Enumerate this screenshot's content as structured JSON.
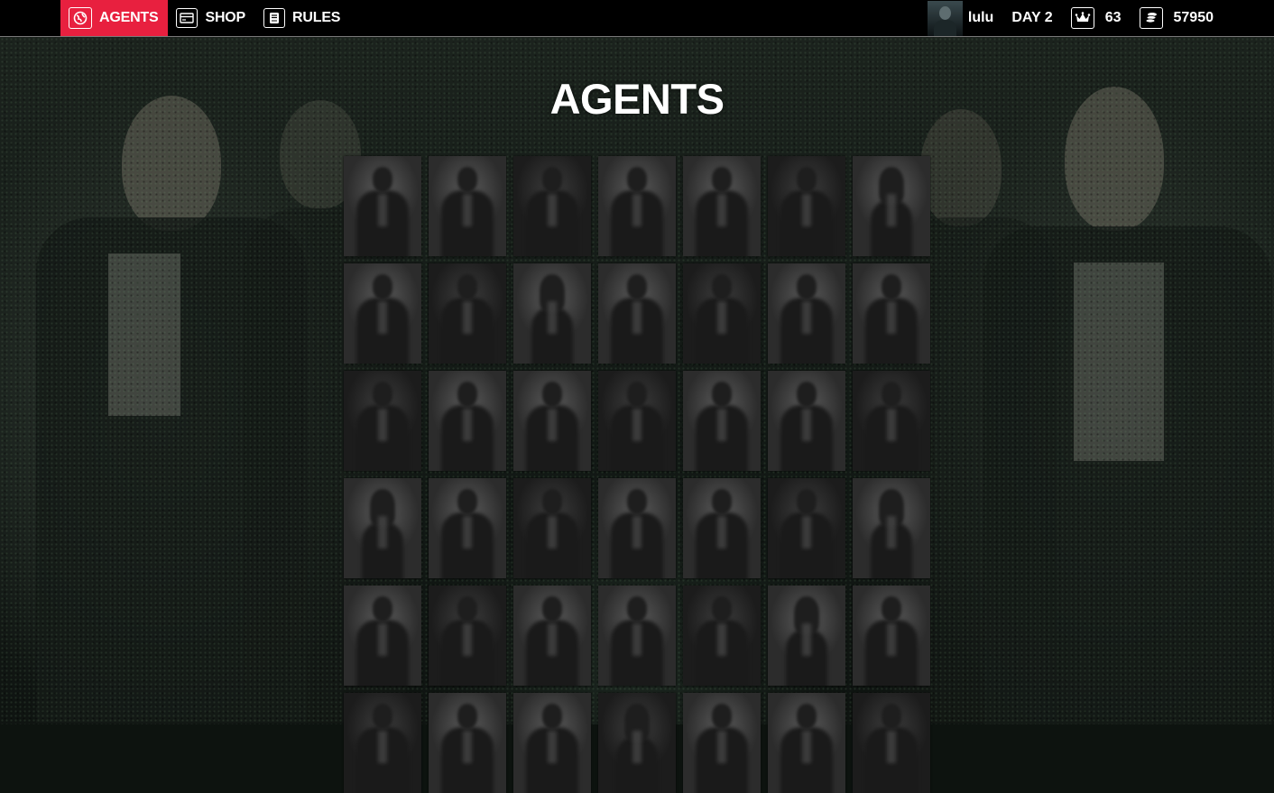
{
  "nav": {
    "items": [
      {
        "label": "AGENTS",
        "icon": "globe-icon",
        "active": true
      },
      {
        "label": "SHOP",
        "icon": "card-icon",
        "active": false
      },
      {
        "label": "RULES",
        "icon": "book-icon",
        "active": false
      }
    ]
  },
  "status": {
    "username": "lulu",
    "day": "DAY 2",
    "crown_value": "63",
    "coins_value": "57950"
  },
  "page": {
    "title": "AGENTS"
  },
  "agents": {
    "rows": [
      [
        "male",
        "male",
        "male",
        "male",
        "male",
        "male",
        "female"
      ],
      [
        "male",
        "male",
        "female",
        "male",
        "male",
        "male",
        "male"
      ],
      [
        "male",
        "male",
        "male",
        "male",
        "male",
        "male",
        "male"
      ],
      [
        "female",
        "male",
        "male",
        "male",
        "male",
        "male",
        "female"
      ],
      [
        "male",
        "male",
        "male",
        "male",
        "male",
        "female",
        "male"
      ],
      [
        "male",
        "male",
        "male",
        "female",
        "male",
        "male",
        "male"
      ]
    ]
  },
  "colors": {
    "accent": "#e8203f",
    "topbar": "#000000"
  }
}
